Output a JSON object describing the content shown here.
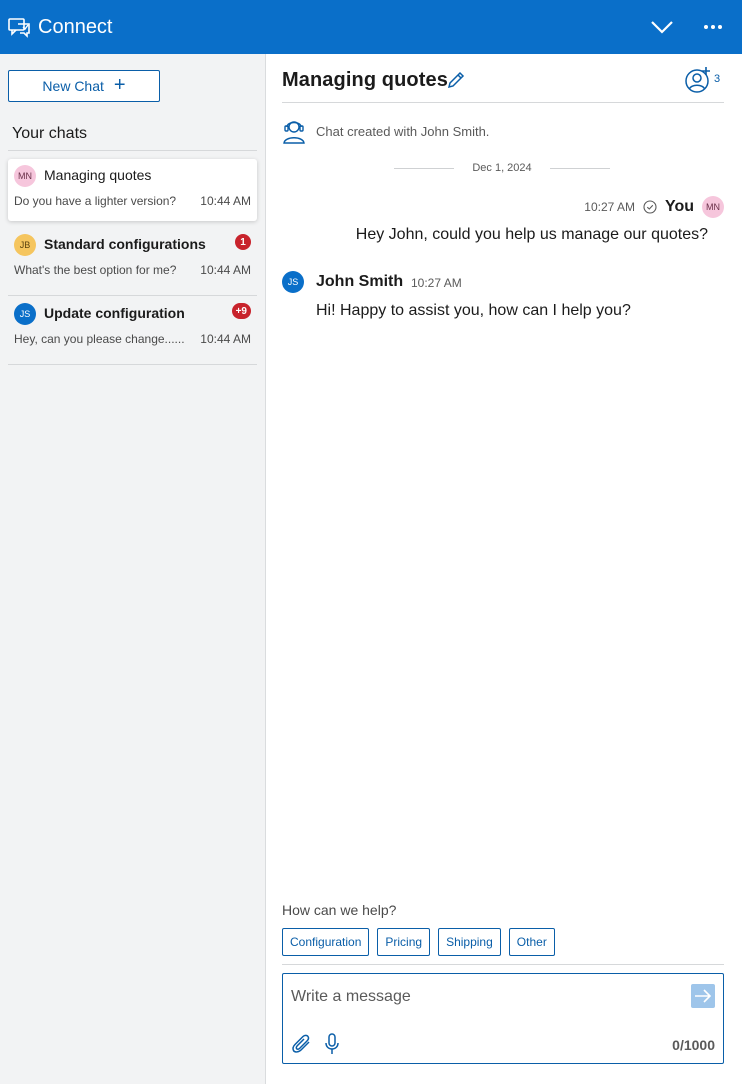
{
  "app": {
    "title": "Connect"
  },
  "sidebar": {
    "new_chat_label": "New Chat",
    "section_title": "Your chats",
    "chats": [
      {
        "initials": "MN",
        "title": "Managing quotes",
        "preview": "Do you have a lighter version?",
        "time": "10:44 AM",
        "badge": ""
      },
      {
        "initials": "JB",
        "title": "Standard configurations",
        "preview": "What's the best option for me?",
        "time": "10:44 AM",
        "badge": "1"
      },
      {
        "initials": "JS",
        "title": "Update configuration",
        "preview": "Hey, can you please change......",
        "time": "10:44 AM",
        "badge": "+9"
      }
    ]
  },
  "conversation": {
    "title": "Managing quotes",
    "participant_count": "3",
    "system_message": "Chat created with John Smith.",
    "date_separator": "Dec 1, 2024",
    "messages": [
      {
        "author": "You",
        "initials": "MN",
        "time": "10:27 AM",
        "text": "Hey John, could you help us manage our quotes?"
      },
      {
        "author": "John Smith",
        "initials": "JS",
        "time": "10:27 AM",
        "text": "Hi! Happy to assist you, how can I help you?"
      }
    ]
  },
  "quick_replies": {
    "prompt": "How can we help?",
    "options": [
      "Configuration",
      "Pricing",
      "Shipping",
      "Other"
    ]
  },
  "composer": {
    "placeholder": "Write a message",
    "counter": "0/1000"
  },
  "colors": {
    "brand": "#0a6fc9",
    "accent": "#0a5ea8",
    "badge": "#c8232c"
  }
}
